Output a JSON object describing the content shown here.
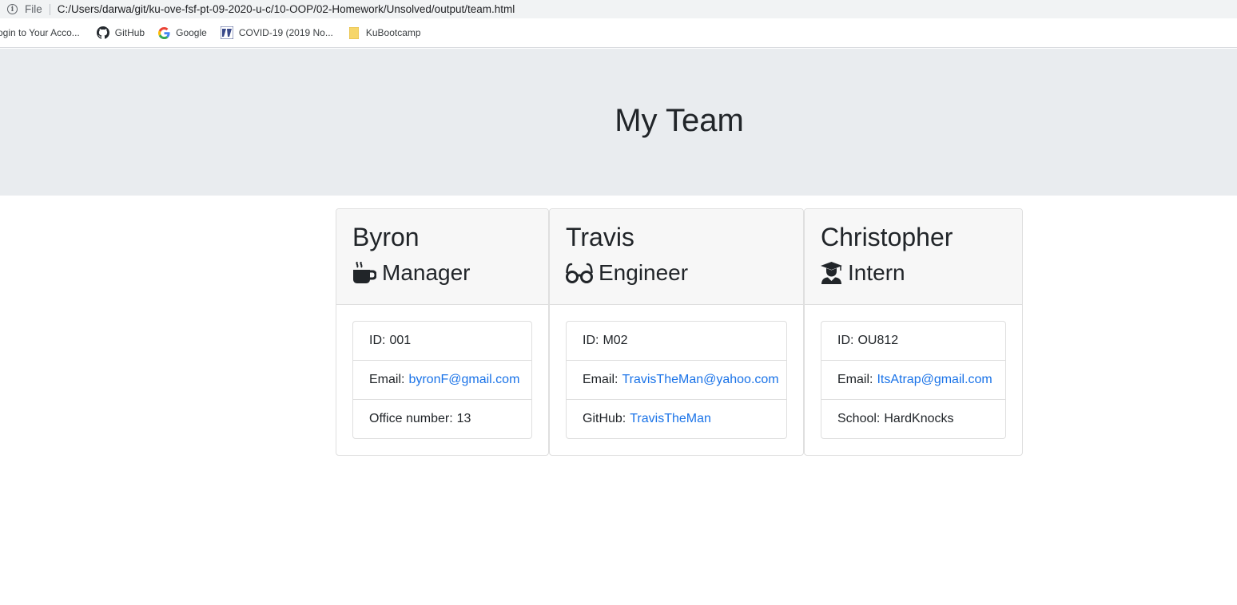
{
  "browser": {
    "file_label": "File",
    "url": "C:/Users/darwa/git/ku-ove-fsf-pt-09-2020-u-c/10-OOP/02-Homework/Unsolved/output/team.html",
    "bookmarks": [
      {
        "label": "ogin to Your Acco...",
        "icon": "none"
      },
      {
        "label": "GitHub",
        "icon": "github-icon"
      },
      {
        "label": "Google",
        "icon": "google-icon"
      },
      {
        "label": "COVID-19 (2019 No...",
        "icon": "covid-site-icon"
      },
      {
        "label": "KuBootcamp",
        "icon": "folder-icon"
      }
    ]
  },
  "page": {
    "title": "My Team"
  },
  "members": [
    {
      "name": "Byron",
      "role": "Manager",
      "role_icon": "mug-icon",
      "id_label": "ID:",
      "id": "001",
      "email_label": "Email:",
      "email": "byronF@gmail.com",
      "extra_label": "Office number:",
      "extra_value": "13"
    },
    {
      "name": "Travis",
      "role": "Engineer",
      "role_icon": "glasses-icon",
      "id_label": "ID:",
      "id": "M02",
      "email_label": "Email:",
      "email": "TravisTheMan@yahoo.com",
      "extra_label": "GitHub:",
      "extra_value": "TravisTheMan"
    },
    {
      "name": "Christopher",
      "role": "Intern",
      "role_icon": "graduate-icon",
      "id_label": "ID:",
      "id": "OU812",
      "email_label": "Email:",
      "email": "ItsAtrap@gmail.com",
      "extra_label": "School:",
      "extra_value": "HardKnocks"
    }
  ],
  "colors": {
    "link": "#1a73e8",
    "jumbotron_bg": "#e9ecef",
    "card_header_bg": "#f7f7f7"
  }
}
